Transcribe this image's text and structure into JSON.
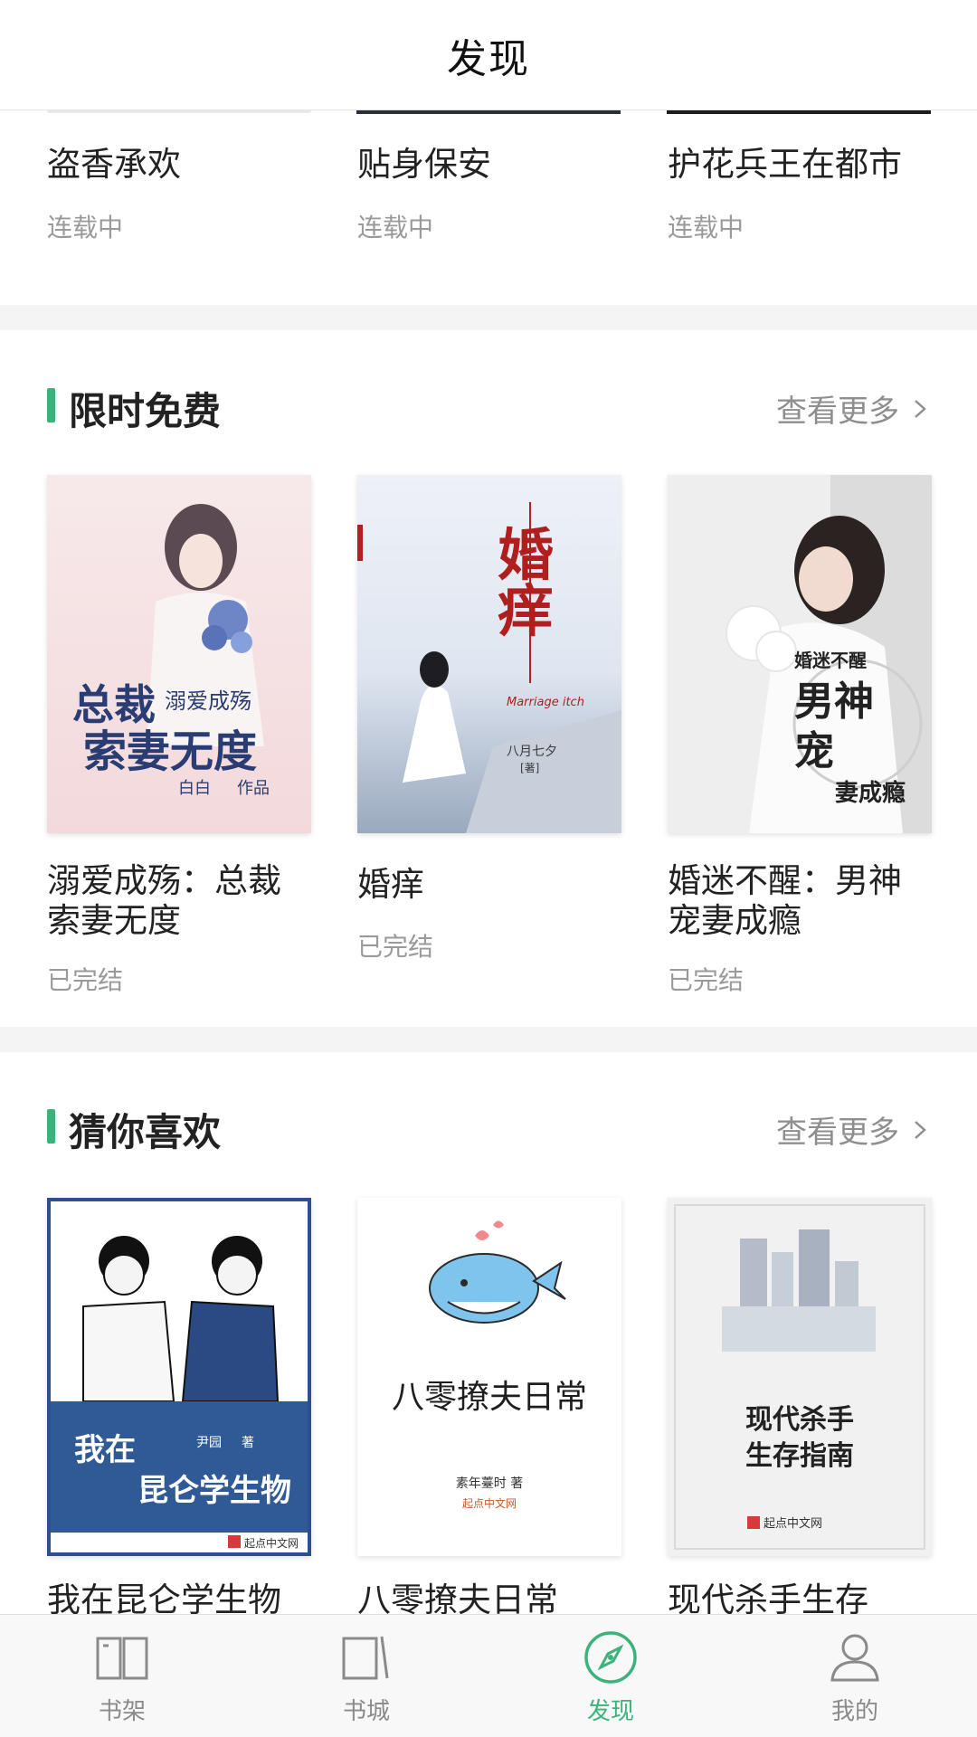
{
  "header": {
    "title": "发现"
  },
  "top_section": {
    "books": [
      {
        "title": "盗香承欢",
        "status": "连载中"
      },
      {
        "title": "贴身保安",
        "status": "连载中"
      },
      {
        "title": "护花兵王在都市",
        "status": "连载中"
      }
    ]
  },
  "free_section": {
    "title": "限时免费",
    "more": "查看更多",
    "books": [
      {
        "title_line1": "溺爱成殇：总裁",
        "title_line2": "索妻无度",
        "status": "已完结",
        "cover_text_1": "总裁",
        "cover_text_2": "溺爱成殇",
        "cover_text_3": "索妻无度",
        "cover_text_4": "白白",
        "cover_text_5": "作品"
      },
      {
        "title_line1": "婚痒",
        "title_line2": "",
        "status": "已完结",
        "cover_text_1": "婚",
        "cover_text_2": "痒",
        "cover_text_3": "Marriage itch",
        "cover_text_4": "八月七夕",
        "cover_text_5": "[著]"
      },
      {
        "title_line1": "婚迷不醒：男神",
        "title_line2": "宠妻成瘾",
        "status": "已完结",
        "cover_text_1": "男神",
        "cover_text_2": "宠",
        "cover_text_3": "妻成瘾",
        "cover_text_4": "婚迷",
        "cover_text_5": "不醒"
      }
    ]
  },
  "guess_section": {
    "title": "猜你喜欢",
    "more": "查看更多",
    "books": [
      {
        "title": "我在昆仑学生物",
        "cover_text_1": "我在",
        "cover_text_2": "昆仑学生物",
        "cover_text_3": "尹园",
        "cover_text_4": "著",
        "cover_text_5": "起点中文网"
      },
      {
        "title": "八零撩夫日常",
        "cover_text_1": "八零撩夫日常",
        "cover_text_2": "素年薹时 著",
        "cover_text_3": "起点中文网"
      },
      {
        "title": "现代杀手生存",
        "cover_text_1": "现代杀手",
        "cover_text_2": "生存指南",
        "cover_text_3": "起点中文网"
      }
    ]
  },
  "tabbar": {
    "items": [
      {
        "label": "书架",
        "icon": "open-book-icon"
      },
      {
        "label": "书城",
        "icon": "bookstore-icon"
      },
      {
        "label": "发现",
        "icon": "compass-icon"
      },
      {
        "label": "我的",
        "icon": "user-icon"
      }
    ],
    "active_color": "#3cb37a",
    "inactive_color": "#8a8a8a"
  },
  "colors": {
    "accent": "#3cb37a",
    "section_gap": "#f4f4f4"
  }
}
